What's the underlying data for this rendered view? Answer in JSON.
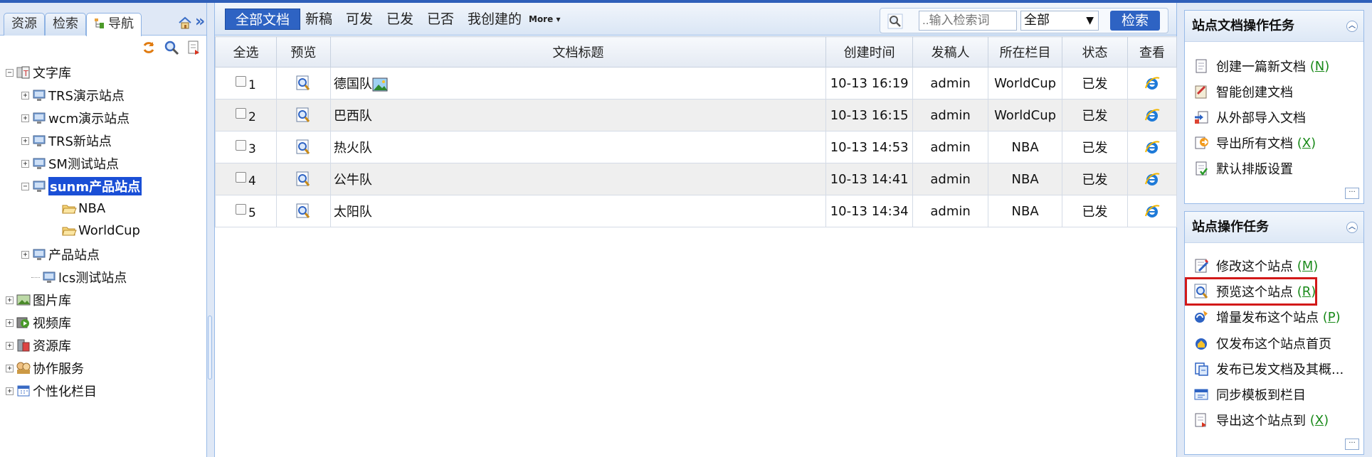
{
  "left_tabs": [
    "资源",
    "检索",
    "导航"
  ],
  "tree": [
    {
      "label": "文字库",
      "level": 0,
      "toggle": "−",
      "icon": "text-library-icon"
    },
    {
      "label": "TRS演示站点",
      "level": 1,
      "toggle": "+",
      "icon": "site-icon"
    },
    {
      "label": "wcm演示站点",
      "level": 1,
      "toggle": "+",
      "icon": "site-icon"
    },
    {
      "label": "TRS新站点",
      "level": 1,
      "toggle": "+",
      "icon": "site-icon"
    },
    {
      "label": "SM测试站点",
      "level": 1,
      "toggle": "+",
      "icon": "site-icon"
    },
    {
      "label": "sunm产品站点",
      "level": 1,
      "toggle": "−",
      "icon": "site-icon",
      "selected": true
    },
    {
      "label": "NBA",
      "level": 2,
      "toggle": "",
      "icon": "folder-icon"
    },
    {
      "label": "WorldCup",
      "level": 2,
      "toggle": "",
      "icon": "folder-icon"
    },
    {
      "label": "产品站点",
      "level": 1,
      "toggle": "+",
      "icon": "site-icon"
    },
    {
      "label": "lcs测试站点",
      "level": 1,
      "toggle": "",
      "icon": "site-icon"
    },
    {
      "label": "图片库",
      "level": 0,
      "toggle": "+",
      "icon": "picture-library-icon"
    },
    {
      "label": "视频库",
      "level": 0,
      "toggle": "+",
      "icon": "video-library-icon"
    },
    {
      "label": "资源库",
      "level": 0,
      "toggle": "+",
      "icon": "resource-library-icon"
    },
    {
      "label": "协作服务",
      "level": 0,
      "toggle": "+",
      "icon": "collaboration-icon"
    },
    {
      "label": "个性化栏目",
      "level": 0,
      "toggle": "+",
      "icon": "custom-column-icon"
    }
  ],
  "filters": {
    "all": "全部文档",
    "draft": "新稿",
    "publishable": "可发",
    "published": "已发",
    "rejected": "已否",
    "mine": "我创建的",
    "more": "More"
  },
  "search": {
    "placeholder": "..输入检索词",
    "scope": "全部",
    "button": "检索"
  },
  "table": {
    "headers": [
      "全选",
      "预览",
      "文档标题",
      "创建时间",
      "发稿人",
      "所在栏目",
      "状态",
      "查看"
    ],
    "rows": [
      {
        "num": "1",
        "title": "德国队",
        "has_image": true,
        "time": "10-13 16:19",
        "author": "admin",
        "column": "WorldCup",
        "status": "已发"
      },
      {
        "num": "2",
        "title": "巴西队",
        "has_image": false,
        "time": "10-13 16:15",
        "author": "admin",
        "column": "WorldCup",
        "status": "已发"
      },
      {
        "num": "3",
        "title": "热火队",
        "has_image": false,
        "time": "10-13 14:53",
        "author": "admin",
        "column": "NBA",
        "status": "已发"
      },
      {
        "num": "4",
        "title": "公牛队",
        "has_image": false,
        "time": "10-13 14:41",
        "author": "admin",
        "column": "NBA",
        "status": "已发"
      },
      {
        "num": "5",
        "title": "太阳队",
        "has_image": false,
        "time": "10-13 14:34",
        "author": "admin",
        "column": "NBA",
        "status": "已发"
      }
    ]
  },
  "doc_panel": {
    "title": "站点文档操作任务",
    "items": [
      {
        "label": "创建一篇新文档",
        "key": "N",
        "icon": "new-document-icon"
      },
      {
        "label": "智能创建文档",
        "key": "",
        "icon": "smart-create-icon"
      },
      {
        "label": "从外部导入文档",
        "key": "",
        "icon": "import-icon"
      },
      {
        "label": "导出所有文档",
        "key": "X",
        "icon": "export-icon"
      },
      {
        "label": "默认排版设置",
        "key": "",
        "icon": "layout-settings-icon"
      }
    ]
  },
  "site_panel": {
    "title": "站点操作任务",
    "items": [
      {
        "label": "修改这个站点",
        "key": "M",
        "icon": "edit-site-icon"
      },
      {
        "label": "预览这个站点",
        "key": "R",
        "icon": "preview-site-icon",
        "highlight": true
      },
      {
        "label": "增量发布这个站点",
        "key": "P",
        "icon": "incremental-publish-icon"
      },
      {
        "label": "仅发布这个站点首页",
        "key": "",
        "icon": "publish-home-icon"
      },
      {
        "label": "发布已发文档及其概...",
        "key": "",
        "icon": "publish-docs-icon"
      },
      {
        "label": "同步模板到栏目",
        "key": "",
        "icon": "sync-template-icon"
      },
      {
        "label": "导出这个站点到",
        "key": "X",
        "icon": "export-site-icon"
      }
    ]
  },
  "colors": {
    "accent": "#2e63c3",
    "selection": "#1a4fd6",
    "highlight_box": "#d21919",
    "shortcut": "#1a8a1a"
  }
}
